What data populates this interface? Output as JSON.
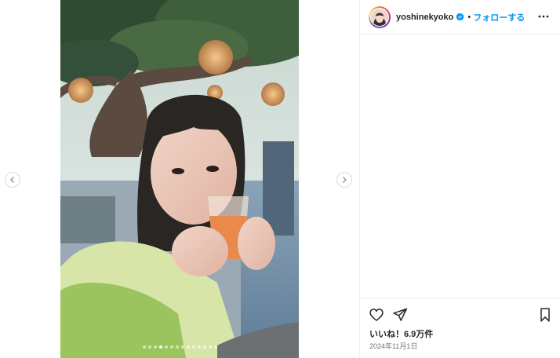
{
  "post": {
    "username": "yoshinekyoko",
    "separator": "•",
    "follow_label": "フォローする",
    "likes_text": "いいね！6.9万件",
    "date_text": "2024年11月1日",
    "carousel": {
      "slide_count": 14,
      "active_slide": 4
    }
  },
  "icons": {
    "verified": "verified-badge-icon",
    "more": "more-options-icon",
    "like": "heart-icon",
    "share": "send-icon",
    "save": "bookmark-icon",
    "prev": "chevron-left-icon",
    "next": "chevron-right-icon"
  },
  "colors": {
    "accent": "#0095f6",
    "text": "#262626",
    "muted": "#737373",
    "border": "#efefef"
  }
}
